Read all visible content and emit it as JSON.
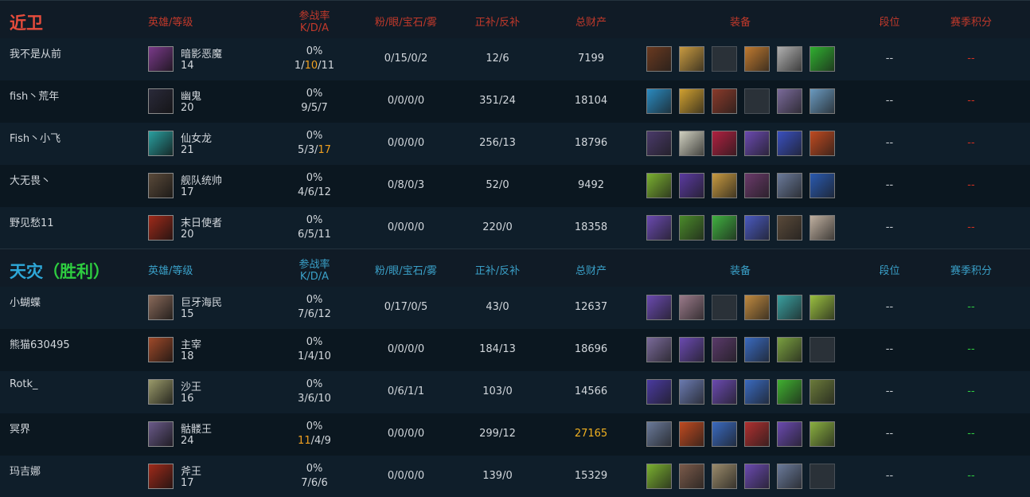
{
  "headers": {
    "hero_level": "英雄/等级",
    "participation": "参战率",
    "kda": "K/D/A",
    "wards": "粉/眼/宝石/雾",
    "cs": "正补/反补",
    "gold": "总财产",
    "items": "装备",
    "rank": "段位",
    "season_score": "赛季积分"
  },
  "teams": [
    {
      "name": "近卫",
      "result": "",
      "players": [
        {
          "name": "我不是从前",
          "hero": "暗影恶魔",
          "level": "14",
          "rate": "0%",
          "kda": [
            "1",
            "10",
            "11"
          ],
          "kda_hl": 1,
          "wards": "0/15/0/2",
          "cs": "12/6",
          "gold": "7199",
          "gold_hl": false,
          "rank": "--",
          "score": "--",
          "hero_color": "#7a3a8a",
          "items": [
            "#6a3a20",
            "#c89a40",
            "",
            "#c07a30",
            "#b0b0b0",
            "#30b030"
          ]
        },
        {
          "name": "fish丶荒年",
          "hero": "幽鬼",
          "level": "20",
          "rate": "0%",
          "kda": [
            "9",
            "5",
            "7"
          ],
          "kda_hl": -1,
          "wards": "0/0/0/0",
          "cs": "351/24",
          "gold": "18104",
          "gold_hl": false,
          "rank": "--",
          "score": "--",
          "hero_color": "#2a2a3a",
          "items": [
            "#2a8ac0",
            "#d0a030",
            "#8a3a2a",
            "",
            "#7a6a9a",
            "#6a9ac0"
          ]
        },
        {
          "name": "Fish丶小飞",
          "hero": "仙女龙",
          "level": "21",
          "rate": "0%",
          "kda": [
            "5",
            "3",
            "17"
          ],
          "kda_hl": 2,
          "wards": "0/0/0/0",
          "cs": "256/13",
          "gold": "18796",
          "gold_hl": false,
          "rank": "--",
          "score": "--",
          "hero_color": "#2aa0a0",
          "items": [
            "#4a3a6a",
            "#d0d0c0",
            "#b02040",
            "#6a4ab0",
            "#3a50c0",
            "#c04a20"
          ]
        },
        {
          "name": "大无畏丶",
          "hero": "舰队统帅",
          "level": "17",
          "rate": "0%",
          "kda": [
            "4",
            "6",
            "12"
          ],
          "kda_hl": -1,
          "wards": "0/8/0/3",
          "cs": "52/0",
          "gold": "9492",
          "gold_hl": false,
          "rank": "--",
          "score": "--",
          "hero_color": "#5a4a3a",
          "items": [
            "#7ab030",
            "#5a3aa0",
            "#c89a40",
            "#6a3a6a",
            "#6a7a9a",
            "#2a5ab0"
          ]
        },
        {
          "name": "野见愁11",
          "hero": "末日使者",
          "level": "20",
          "rate": "0%",
          "kda": [
            "6",
            "5",
            "11"
          ],
          "kda_hl": -1,
          "wards": "0/0/0/0",
          "cs": "220/0",
          "gold": "18358",
          "gold_hl": false,
          "rank": "--",
          "score": "--",
          "hero_color": "#a02a1a",
          "items": [
            "#6a4ab0",
            "#4a8a2a",
            "#40b040",
            "#4a5ac0",
            "#5a4a3a",
            "#c0b0a0"
          ]
        }
      ]
    },
    {
      "name": "天灾",
      "result": "（胜利）",
      "players": [
        {
          "name": "小蝴蝶",
          "hero": "巨牙海民",
          "level": "15",
          "rate": "0%",
          "kda": [
            "7",
            "6",
            "12"
          ],
          "kda_hl": -1,
          "wards": "0/17/0/5",
          "cs": "43/0",
          "gold": "12637",
          "gold_hl": false,
          "rank": "--",
          "score": "--",
          "hero_color": "#8a6a5a",
          "items": [
            "#6a4ab0",
            "#9a7a8a",
            "",
            "#c08a40",
            "#3aa0a0",
            "#9ac040"
          ]
        },
        {
          "name": "熊猫630495",
          "hero": "主宰",
          "level": "18",
          "rate": "0%",
          "kda": [
            "1",
            "4",
            "10"
          ],
          "kda_hl": -1,
          "wards": "0/0/0/0",
          "cs": "184/13",
          "gold": "18696",
          "gold_hl": false,
          "rank": "--",
          "score": "--",
          "hero_color": "#a04a2a",
          "items": [
            "#7a6a9a",
            "#6a4ab0",
            "#5a3a6a",
            "#3a6ac0",
            "#7aa040",
            ""
          ]
        },
        {
          "name": "Rotk_",
          "hero": "沙王",
          "level": "16",
          "rate": "0%",
          "kda": [
            "3",
            "6",
            "10"
          ],
          "kda_hl": -1,
          "wards": "0/6/1/1",
          "cs": "103/0",
          "gold": "14566",
          "gold_hl": false,
          "rank": "--",
          "score": "--",
          "hero_color": "#9a9a6a",
          "items": [
            "#4a3aa0",
            "#6a7ab0",
            "#6a4ab0",
            "#3a6ac0",
            "#40b030",
            "#6a7a3a"
          ]
        },
        {
          "name": "冥界",
          "hero": "骷髅王",
          "level": "24",
          "rate": "0%",
          "kda": [
            "11",
            "4",
            "9"
          ],
          "kda_hl": 0,
          "wards": "0/0/0/0",
          "cs": "299/12",
          "gold": "27165",
          "gold_hl": true,
          "rank": "--",
          "score": "--",
          "hero_color": "#6a5a8a",
          "items": [
            "#6a7a9a",
            "#c04a20",
            "#3a6ac0",
            "#b03030",
            "#6a4ab0",
            "#8ab040"
          ]
        },
        {
          "name": "玛吉娜",
          "hero": "斧王",
          "level": "17",
          "rate": "0%",
          "kda": [
            "7",
            "6",
            "6"
          ],
          "kda_hl": -1,
          "wards": "0/0/0/0",
          "cs": "139/0",
          "gold": "15329",
          "gold_hl": false,
          "rank": "--",
          "score": "--",
          "hero_color": "#a02a1a",
          "items": [
            "#7ab030",
            "#7a5a4a",
            "#9a8a6a",
            "#6a4ab0",
            "#6a7a9a",
            ""
          ]
        }
      ]
    }
  ]
}
